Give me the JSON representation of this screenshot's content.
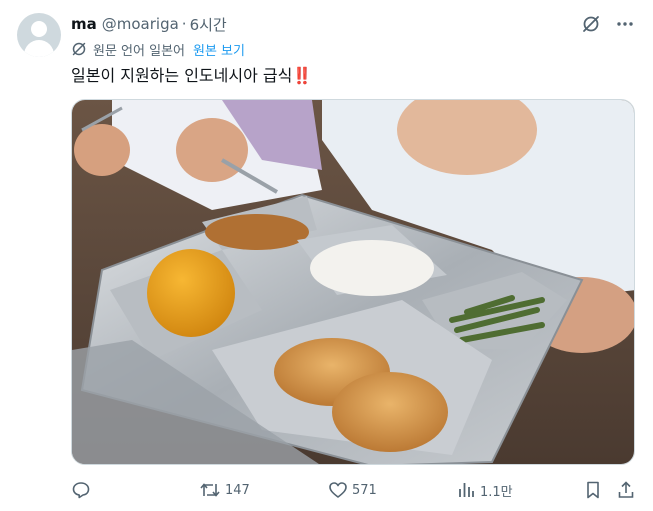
{
  "tweet": {
    "author": {
      "name": "ma",
      "handle": "@moariga",
      "separator": "·",
      "time": "6시간"
    },
    "translation": {
      "notice": "원문 언어 일본어",
      "show_original": "원본 보기"
    },
    "text": "일본이 지원하는 인도네시아 급식",
    "text_emoji": "‼️",
    "media": {
      "description_icon": "photo-lunch-tray"
    },
    "actions": {
      "reply_count": "",
      "retweet_count": "147",
      "like_count": "571",
      "views_count": "1.1만"
    },
    "icons": [
      "grok-icon",
      "more-icon",
      "translate-icon",
      "reply-icon",
      "retweet-icon",
      "like-icon",
      "views-icon",
      "bookmark-icon",
      "share-icon"
    ],
    "colors": {
      "accent": "#1d9bf0",
      "text": "#0f1419",
      "secondary": "#536471",
      "emoji_red": "#dc2f45"
    }
  }
}
